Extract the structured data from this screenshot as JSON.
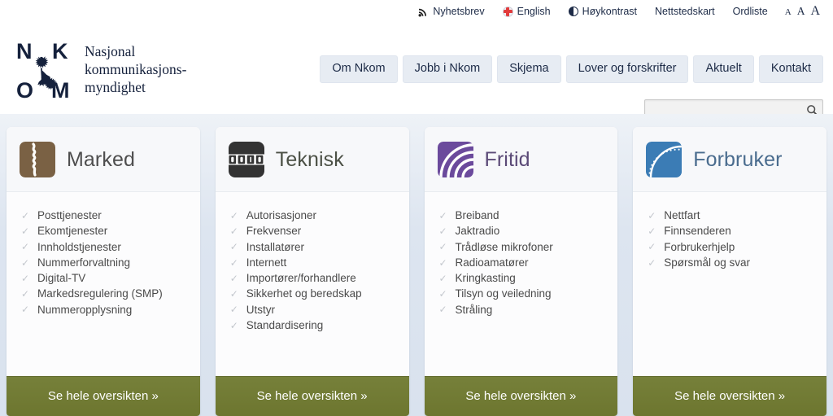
{
  "utility": {
    "links": [
      {
        "label": "Nyhetsbrev",
        "icon": "rss-icon"
      },
      {
        "label": "English",
        "icon": "flag-icon"
      },
      {
        "label": "Høykontrast",
        "icon": "contrast-icon"
      },
      {
        "label": "Nettstedskart",
        "icon": ""
      },
      {
        "label": "Ordliste",
        "icon": ""
      }
    ],
    "text_sizes": [
      "A",
      "A",
      "A"
    ]
  },
  "brand": {
    "logo_letters": [
      "N",
      "K",
      "O",
      "M"
    ],
    "name_line1": "Nasjonal",
    "name_line2": "kommunikasjons-",
    "name_line3": "myndighet"
  },
  "nav": {
    "items": [
      "Om Nkom",
      "Jobb i Nkom",
      "Skjema",
      "Lover og forskrifter",
      "Aktuelt",
      "Kontakt"
    ]
  },
  "search": {
    "value": "",
    "placeholder": "",
    "icon": "search-icon"
  },
  "cards": [
    {
      "title": "Marked",
      "icon": "market-map-icon",
      "icon_color": "#7a6144",
      "title_color": "#4e4e4e",
      "items": [
        "Posttjenester",
        "Ekomtjenester",
        "Innholdstjenester",
        "Nummerforvaltning",
        "Digital-TV",
        "Markedsregulering (SMP)",
        "Nummeropplysning"
      ],
      "cta": "Se hele oversikten »"
    },
    {
      "title": "Teknisk",
      "icon": "binary-digits-icon",
      "icon_color": "#333333",
      "title_color": "#4c5146",
      "items": [
        "Autorisasjoner",
        "Frekvenser",
        "Installatører",
        "Internett",
        "Importører/forhandlere",
        "Sikkerhet og beredskap",
        "Utstyr",
        "Standardisering"
      ],
      "cta": "Se hele oversikten »"
    },
    {
      "title": "Fritid",
      "icon": "radio-waves-icon",
      "icon_color": "#6b4a9c",
      "title_color": "#5b4a77",
      "items": [
        "Breiband",
        "Jaktradio",
        "Trådløse mikrofoner",
        "Radioamatører",
        "Kringkasting",
        "Tilsyn og veiledning",
        "Stråling"
      ],
      "cta": "Se hele oversikten »"
    },
    {
      "title": "Forbruker",
      "icon": "speedometer-icon",
      "icon_color": "#3b7cb5",
      "title_color": "#4a6c8e",
      "items": [
        "Nettfart",
        "Finnsenderen",
        "Forbrukerhjelp",
        "Spørsmål og svar"
      ],
      "cta": "Se hele oversikten »"
    }
  ],
  "colors": {
    "page_bg": "#dde5f0",
    "cta_green": "#76803a",
    "nav_button": "#e7ecf3",
    "brand_navy": "#15213c"
  }
}
